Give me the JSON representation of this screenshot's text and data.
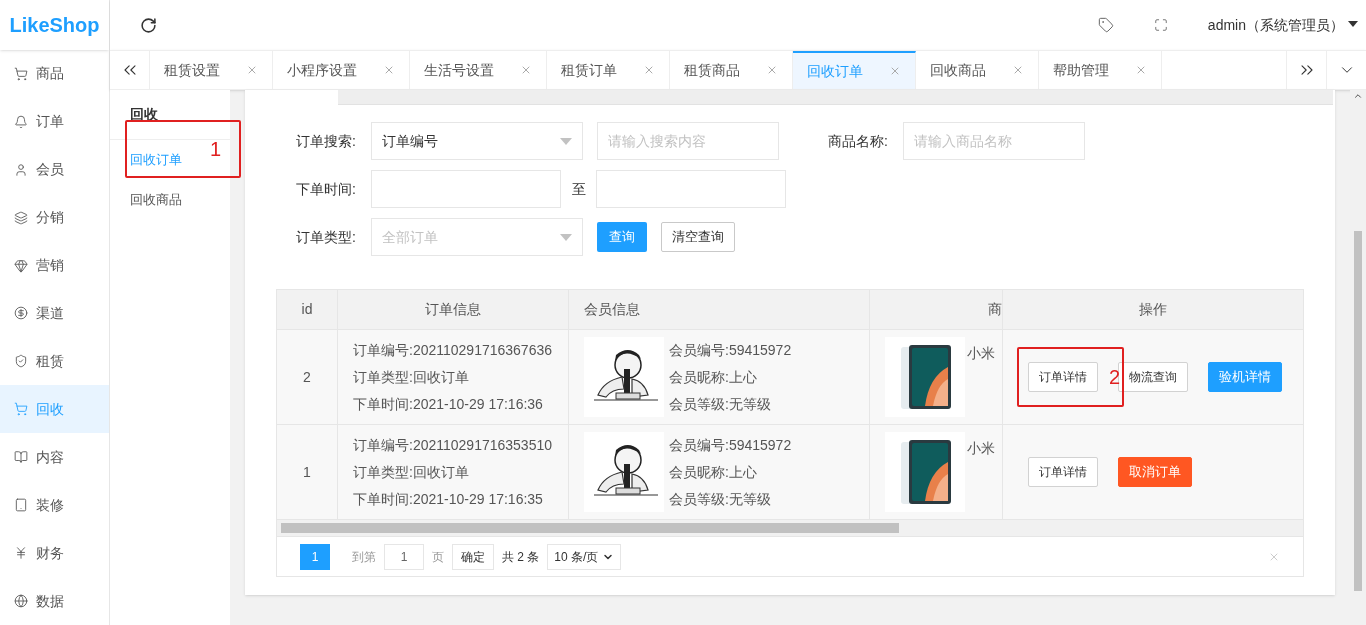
{
  "logo": {
    "text": "LikeShop"
  },
  "header": {
    "user": "admin（系统管理员）"
  },
  "sidebar": {
    "items": [
      {
        "label": "商品",
        "selected": false
      },
      {
        "label": "订单",
        "selected": false
      },
      {
        "label": "会员",
        "selected": false
      },
      {
        "label": "分销",
        "selected": false
      },
      {
        "label": "营销",
        "selected": false
      },
      {
        "label": "渠道",
        "selected": false
      },
      {
        "label": "租赁",
        "selected": false
      },
      {
        "label": "回收",
        "selected": true
      },
      {
        "label": "内容",
        "selected": false
      },
      {
        "label": "装修",
        "selected": false
      },
      {
        "label": "财务",
        "selected": false
      },
      {
        "label": "数据",
        "selected": false
      }
    ]
  },
  "tabs": [
    {
      "label": "租赁设置",
      "selected": false
    },
    {
      "label": "小程序设置",
      "selected": false
    },
    {
      "label": "生活号设置",
      "selected": false
    },
    {
      "label": "租赁订单",
      "selected": false
    },
    {
      "label": "租赁商品",
      "selected": false
    },
    {
      "label": "回收订单",
      "selected": true
    },
    {
      "label": "回收商品",
      "selected": false
    },
    {
      "label": "帮助管理",
      "selected": false
    }
  ],
  "submenu": {
    "title": "回收",
    "items": [
      {
        "label": "回收订单",
        "selected": true
      },
      {
        "label": "回收商品",
        "selected": false
      }
    ]
  },
  "filters": {
    "search_label": "订单搜索:",
    "search_type": "订单编号",
    "search_placeholder": "请输入搜索内容",
    "goods_label": "商品名称:",
    "goods_placeholder": "请输入商品名称",
    "time_label": "下单时间:",
    "time_to": "至",
    "type_label": "订单类型:",
    "type_placeholder": "全部订单",
    "query": "查询",
    "clear": "清空查询"
  },
  "table": {
    "columns": [
      "id",
      "订单信息",
      "会员信息",
      "商",
      "操作"
    ],
    "rows": [
      {
        "id": "2",
        "order": [
          "订单编号:202110291716367636",
          "订单类型:回收订单",
          "下单时间:2021-10-29 17:16:36"
        ],
        "member": [
          "会员编号:59415972",
          "会员昵称:上心",
          "会员等级:无等级"
        ],
        "goods": "小米",
        "actions": [
          {
            "label": "订单详情",
            "kind": "plain"
          },
          {
            "label": "物流查询",
            "kind": "plain"
          },
          {
            "label": "验机详情",
            "kind": "primary"
          }
        ]
      },
      {
        "id": "1",
        "order": [
          "订单编号:202110291716353510",
          "订单类型:回收订单",
          "下单时间:2021-10-29 17:16:35"
        ],
        "member": [
          "会员编号:59415972",
          "会员昵称:上心",
          "会员等级:无等级"
        ],
        "goods": "小米",
        "actions": [
          {
            "label": "订单详情",
            "kind": "plain"
          },
          {
            "label": "取消订单",
            "kind": "danger"
          }
        ]
      }
    ]
  },
  "pagination": {
    "pages": [
      {
        "label": "1",
        "selected": true
      }
    ],
    "goto": "到第",
    "page_value": "1",
    "page_unit": "页",
    "confirm": "确定",
    "total": "共 2 条",
    "per_page": "10 条/页"
  },
  "annotations": [
    "1",
    "2"
  ]
}
